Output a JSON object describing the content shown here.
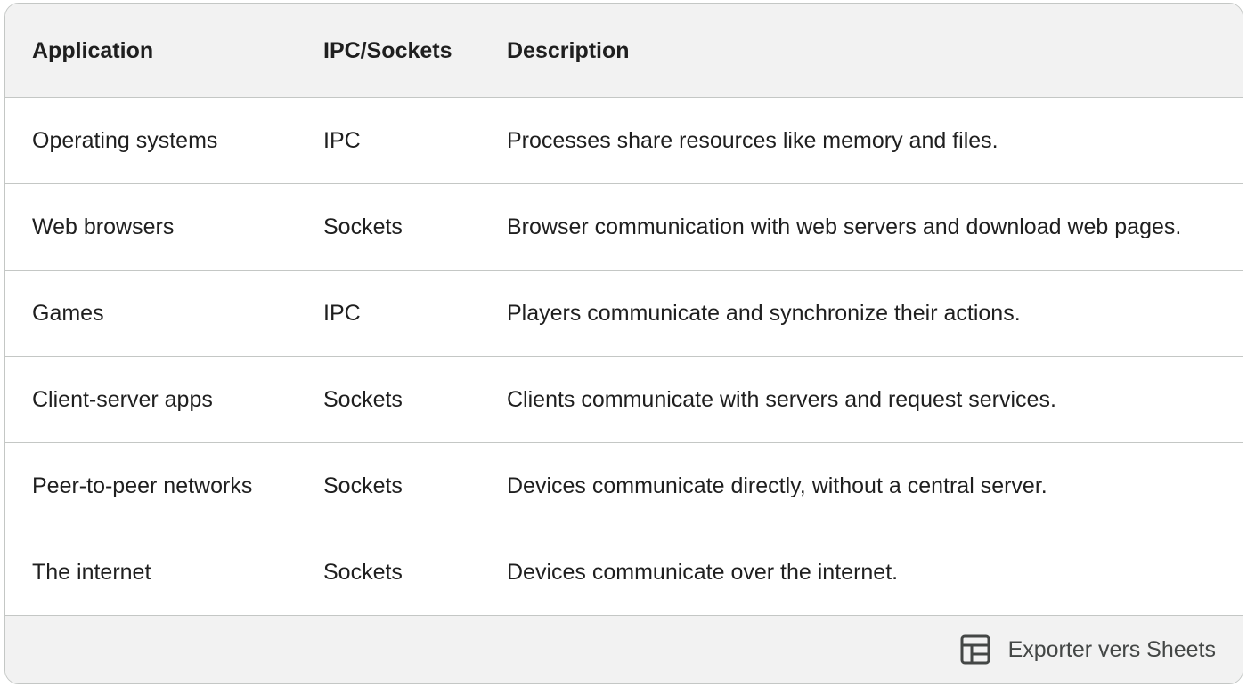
{
  "table": {
    "headers": {
      "application": "Application",
      "ipc_sockets": "IPC/Sockets",
      "description": "Description"
    },
    "rows": [
      {
        "application": "Operating systems",
        "ipc_sockets": "IPC",
        "description": "Processes share resources like memory and files."
      },
      {
        "application": "Web browsers",
        "ipc_sockets": "Sockets",
        "description": "Browser communication with web servers and download web pages."
      },
      {
        "application": "Games",
        "ipc_sockets": "IPC",
        "description": "Players communicate and synchronize their actions."
      },
      {
        "application": "Client-server apps",
        "ipc_sockets": "Sockets",
        "description": "Clients communicate with servers and request services."
      },
      {
        "application": "Peer-to-peer networks",
        "ipc_sockets": "Sockets",
        "description": "Devices communicate directly, without a central server."
      },
      {
        "application": "The internet",
        "ipc_sockets": "Sockets",
        "description": "Devices communicate over the internet."
      }
    ]
  },
  "footer": {
    "export_label": "Exporter vers Sheets",
    "export_icon": "table-icon"
  },
  "colors": {
    "header_bg": "#f2f2f2",
    "border": "#c4c7c5",
    "text": "#1f1f1f",
    "footer_text": "#444746"
  }
}
